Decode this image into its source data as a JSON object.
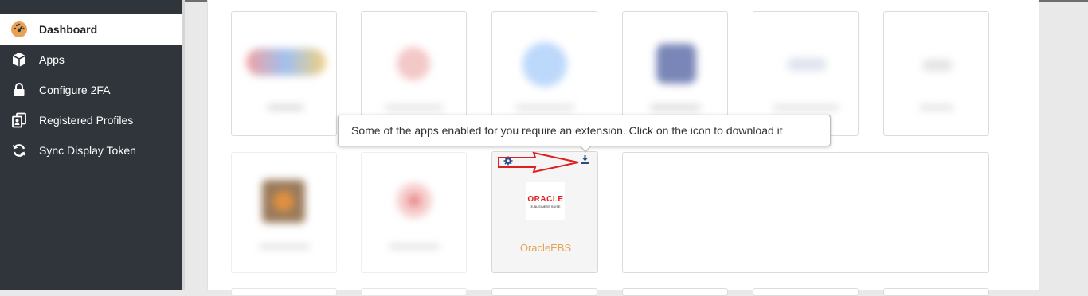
{
  "sidebar": {
    "items": [
      {
        "label": "Dashboard",
        "icon": "dashboard-gauge-icon",
        "active": true
      },
      {
        "label": "Apps",
        "icon": "cube-icon",
        "active": false
      },
      {
        "label": "Configure 2FA",
        "icon": "lock-icon",
        "active": false
      },
      {
        "label": "Registered Profiles",
        "icon": "profiles-icon",
        "active": false
      },
      {
        "label": "Sync Display Token",
        "icon": "sync-icon",
        "active": false
      }
    ]
  },
  "tooltip": {
    "text": "Some of the apps enabled for you require an extension. Click on the icon to download it"
  },
  "app_card": {
    "name": "OracleEBS",
    "logo_text": "ORACLE",
    "logo_subtext": "E-BUSINESS SUITE",
    "settings_icon": "gear-icon",
    "download_icon": "download-icon"
  },
  "colors": {
    "sidebar_bg": "#2f353b",
    "accent_orange": "#e8a256",
    "oracle_red": "#e02020",
    "annotation_arrow": "#e02020"
  }
}
